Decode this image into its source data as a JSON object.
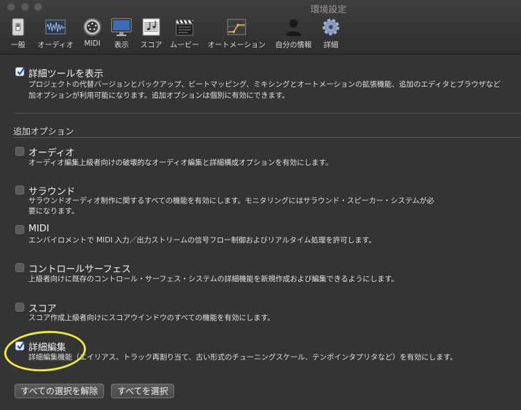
{
  "window": {
    "title": "環境設定"
  },
  "toolbar": {
    "items": [
      {
        "label": "一般",
        "icon": "switch-icon"
      },
      {
        "label": "オーディオ",
        "icon": "audio-waveform-icon"
      },
      {
        "label": "MIDI",
        "icon": "midi-connector-icon"
      },
      {
        "label": "表示",
        "icon": "monitor-icon"
      },
      {
        "label": "スコア",
        "icon": "score-icon"
      },
      {
        "label": "ムービー",
        "icon": "clapperboard-icon"
      },
      {
        "label": "オートメーション",
        "icon": "automation-icon"
      },
      {
        "label": "自分の情報",
        "icon": "person-icon"
      },
      {
        "label": "詳細",
        "icon": "gear-icon"
      }
    ]
  },
  "main": {
    "advanced_tools": {
      "title": "詳細ツールを表示",
      "checked": true,
      "desc_line1": "プロジェクトの代替バージョンとバックアップ、ビートマッピング、ミキシングとオートメーションの拡張機能、追加のエディタとブラウザなど",
      "desc_line2": "加オプションが利用可能になります。追加オプションは個別に有効にできます。"
    },
    "additional_options_label": "追加オプション",
    "options": [
      {
        "title": "オーディオ",
        "checked": false,
        "desc": [
          "オーディオ編集上級者向けの破壊的なオーディオ編集と詳細構成オプションを有効にします。"
        ]
      },
      {
        "title": "サラウンド",
        "checked": false,
        "desc": [
          "サラウンドオーディオ制作に関するすべての機能を有効にします。モニタリングにはサラウンド・スピーカー・システムが必",
          "要になります。"
        ]
      },
      {
        "title": "MIDI",
        "checked": false,
        "desc": [
          "エンバイロメントで MIDI 入力／出力ストリームの信号フロー制御およびリアルタイム処理を許可します。"
        ]
      },
      {
        "title": "コントロールサーフェス",
        "checked": false,
        "desc": [
          "上級者向けに既存のコントロール・サーフェス・システムの詳細機能を新規作成および編集できるようにします。"
        ]
      },
      {
        "title": "スコア",
        "checked": false,
        "desc": [
          "スコア作成上級者向けにスコアウインドウのすべての機能を有効にします。"
        ]
      },
      {
        "title": "詳細編集",
        "checked": true,
        "desc": [
          "詳細編集機能（エイリアス、トラック再割り当て、古い形式のチューニングスケール、テンポインタプリタなど）を有効にします。"
        ]
      }
    ],
    "buttons": {
      "deselect_all": "すべての選択を解除",
      "select_all": "すべてを選択"
    }
  },
  "colors": {
    "background": "#343434",
    "highlight": "#f1ea3a",
    "checkbox_checked": "#eaf2ff"
  }
}
